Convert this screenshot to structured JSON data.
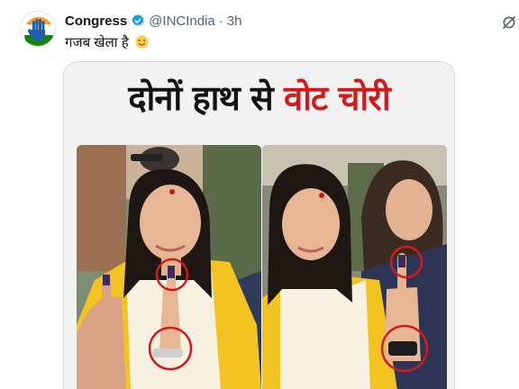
{
  "tweet": {
    "display_name": "Congress",
    "handle": "@INCIndia",
    "separator": "·",
    "time": "3h",
    "text": "गजब खेला है",
    "icons": {
      "avatar": "congress-hand-logo",
      "verified": "verified-badge-icon",
      "emoji": "winking-face-emoji",
      "grok": "grok-icon"
    },
    "colors": {
      "verified": "#1d9bf0",
      "headline_red": "#d11a1a",
      "circle_red": "#d11a1a"
    }
  },
  "media": {
    "headline_black": "दोनों हाथ से",
    "headline_red": "वोट चोरी"
  }
}
